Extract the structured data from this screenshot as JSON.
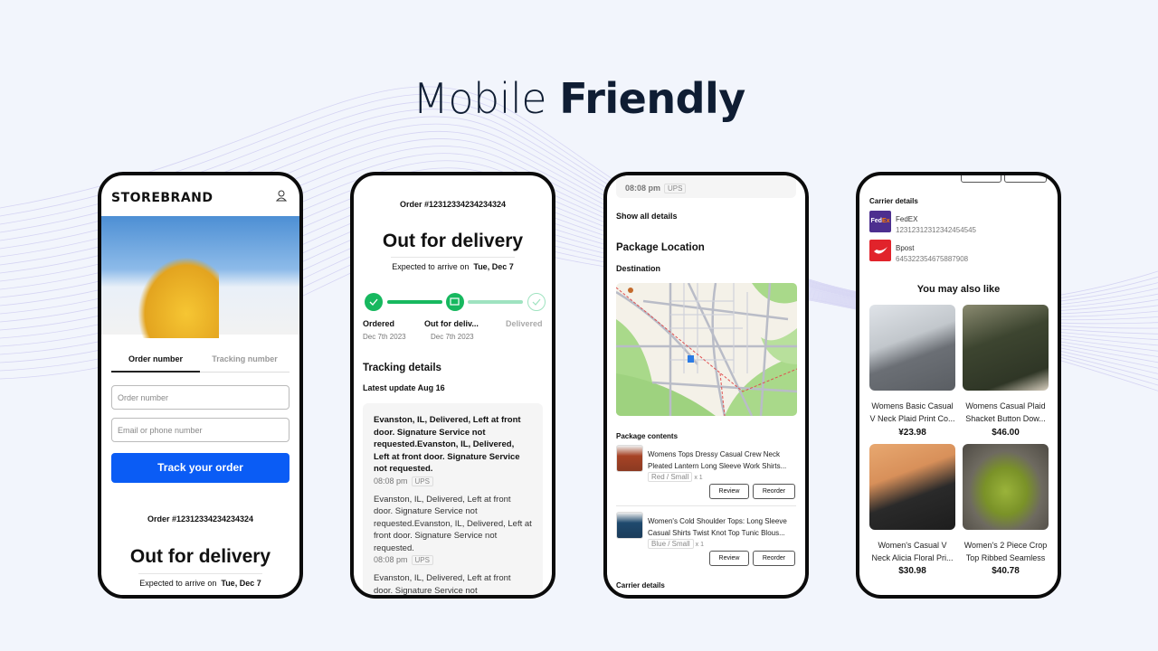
{
  "headline": {
    "light": "Mobile",
    "bold": "Friendly"
  },
  "colors": {
    "accent": "#0a5cf5",
    "success": "#17b85f",
    "success_light": "#9fe3c0"
  },
  "phone1": {
    "brand": "STOREBRAND",
    "account_icon": "user-icon",
    "tabs": [
      {
        "label": "Order number",
        "active": true
      },
      {
        "label": "Tracking number",
        "active": false
      }
    ],
    "order_placeholder": "Order number",
    "contact_placeholder": "Email or phone number",
    "track_button": "Track your order",
    "order_id": "Order #12312334234234324",
    "status": "Out for delivery",
    "expected_label": "Expected to arrive on",
    "expected_date": "Tue, Dec 7"
  },
  "phone2": {
    "order_id": "Order #12312334234234324",
    "status": "Out for delivery",
    "expected_label": "Expected to arrive on",
    "expected_date": "Tue, Dec 7",
    "steps": [
      {
        "label": "Ordered",
        "date": "Dec 7th 2023",
        "state": "done"
      },
      {
        "label": "Out for deliv...",
        "date": "Dec 7th 2023",
        "state": "current"
      },
      {
        "label": "Delivered",
        "date": "",
        "state": "pending"
      }
    ],
    "tracking_title": "Tracking details",
    "latest_update": "Latest update Aug 16",
    "events": [
      {
        "text": "Evanston, IL, Delivered, Left at front door. Signature Service not requested.Evanston, IL, Delivered, Left at front door. Signature Service not requested.",
        "time": "08:08 pm",
        "carrier": "UPS"
      },
      {
        "text": "Evanston, IL, Delivered, Left at front door. Signature Service not requested.Evanston, IL, Delivered, Left at front door. Signature Service not requested.",
        "time": "08:08 pm",
        "carrier": "UPS"
      },
      {
        "text": "Evanston, IL, Delivered, Left at front door. Signature Service not requested.Evanston, IL, Delivered, Left at front door. Signature"
      }
    ]
  },
  "phone3": {
    "top_time": "08:08 pm",
    "top_carrier": "UPS",
    "show_all": "Show all details",
    "location_title": "Package Location",
    "destination": "Destination",
    "contents_title": "Package contents",
    "items": [
      {
        "title1": "Womens Tops Dressy Casual Crew Neck",
        "title2": "Pleated Lantern Long Sleeve Work Shirts...",
        "variant": "Red / Small",
        "qty": "x 1",
        "review": "Review",
        "reorder": "Reorder"
      },
      {
        "title1": "Women's Cold Shoulder Tops: Long Sleeve",
        "title2": "Casual Shirts Twist Knot Top Tunic Blous...",
        "variant": "Blue / Small",
        "qty": "x 1",
        "review": "Review",
        "reorder": "Reorder"
      }
    ],
    "carrier_title": "Carrier details"
  },
  "phone4": {
    "carrier_title": "Carrier details",
    "carriers": [
      {
        "name": "FedEX",
        "number": "12312312312342454545",
        "logo": "FedEx"
      },
      {
        "name": "Bpost",
        "number": "645322354675887908"
      }
    ],
    "recommend_title": "You may also like",
    "products": [
      {
        "line1": "Womens Basic Casual",
        "line2": "V Neck Plaid Print Co...",
        "price": "¥23.98"
      },
      {
        "line1": "Womens Casual Plaid",
        "line2": "Shacket Button Dow...",
        "price": "$46.00"
      },
      {
        "line1": "Women's Casual V",
        "line2": "Neck Alicia Floral Pri...",
        "price": "$30.98"
      },
      {
        "line1": "Women's 2 Piece Crop",
        "line2": "Top Ribbed Seamless",
        "price": "$40.78"
      }
    ]
  }
}
